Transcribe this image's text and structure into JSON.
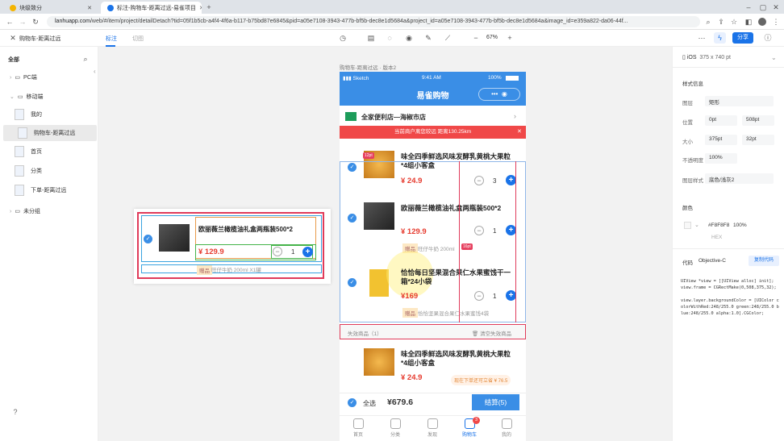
{
  "browser": {
    "tabs": [
      {
        "title": "块级致分",
        "favicon_color": "#f4b400"
      },
      {
        "title": "标注-购物车-距离过远-易雀项目",
        "favicon_color": "#1a73e8"
      }
    ],
    "url_host": "lanhuapp.com",
    "url_rest": "/web/#/item/project/detailDetach?tid=05f1b5cb-a4f4-4f6a-b117-b75bd87e6845&pid=a05e7108-3943-477b-bf5b-dec8e1d5684a&project_id=a05e7108-3943-477b-bf5b-dec8e1d5684a&image_id=e359a822-da06-44f..."
  },
  "app": {
    "breadcrumb": "购物车-距离过远",
    "tabs": [
      "标注",
      "切图"
    ],
    "zoom": "67%",
    "share_label": "分享"
  },
  "sidebar": {
    "header": "全部",
    "groups": [
      {
        "label": "PC端"
      },
      {
        "label": "移动端"
      }
    ],
    "pages": [
      {
        "label": "我的"
      },
      {
        "label": "购物车-距离过远"
      },
      {
        "label": "首页"
      },
      {
        "label": "分类"
      },
      {
        "label": "下单-距离过远"
      }
    ],
    "ungrouped": "未分组",
    "help": "?"
  },
  "artboard": {
    "title": "购物车-距离过远 · 版本2"
  },
  "phone": {
    "status": {
      "carrier": "Sketch",
      "time": "9:41 AM",
      "battery": "100%"
    },
    "nav_title": "易雀购物",
    "store": "全家便利店—海椒市店",
    "warning": "当前商户离您较远 距离130.25km",
    "items": [
      {
        "title": "味全四季鲜选风味发酵乳黄桃大果粒*4组小客盒",
        "price": "¥ 24.9",
        "qty": "3",
        "badge": "12pt"
      },
      {
        "title": "欧丽薇兰橄榄油礼盒两瓶装500*2",
        "price": "¥ 129.9",
        "qty": "1",
        "gift_tag": "赠品",
        "gift": "旺仔牛奶 200ml",
        "badge": "16pt"
      },
      {
        "title": "恰恰每日坚果混合果仁水果蜜饯干一箱*24小袋",
        "price": "¥169",
        "qty": "1",
        "gift_tag": "赠品",
        "gift": "恰恰坚果混合果仁水果蜜饯4袋"
      }
    ],
    "invalid_label": "失效商品（1）",
    "clear_label": "清空失效商品",
    "invalid_item": {
      "title": "味全四季鲜选风味发酵乳黄桃大果粒*4组小客盒",
      "price": "¥ 24.9",
      "note": "现在下单还可立省 ¥ 76.5"
    },
    "footer": {
      "select_all": "全选",
      "total": "¥679.6",
      "checkout": "结算(5)"
    },
    "tabbar": [
      "首页",
      "分类",
      "发现",
      "购物车",
      "我的"
    ],
    "cart_count": "3"
  },
  "zoom_card": {
    "title": "欧丽薇兰橄榄油礼盒两瓶装500*2",
    "price": "¥ 129.9",
    "qty": "1",
    "gift_tag": "赠品",
    "gift": "旺仔牛奶 200ml X1罐"
  },
  "inspector": {
    "device": "iOS",
    "device_size": "375 x 740 pt",
    "section_style": "样式信息",
    "layer_label": "图层",
    "layer_value": "矩形",
    "pos_label": "位置",
    "pos_x": "0pt",
    "pos_y": "508pt",
    "size_label": "大小",
    "size_w": "375pt",
    "size_h": "32pt",
    "opacity_label": "不透明度",
    "opacity": "100%",
    "style_label": "图层样式",
    "style_value": "底色/浅灰2",
    "color_label": "颜色",
    "color_hex": "#F8F8F8",
    "color_pct": "100%",
    "color_mode": "HEX",
    "code_label": "代码",
    "code_lang": "Objective-C",
    "copy_label": "复制代码",
    "code": "UIView *view = [[UIView alloc] init];\nview.frame = CGRectMake(0,508,375,32);\n\nview.layer.backgroundColor = [UIColor colorWithRed:248/255.0 green:248/255.0 blue:248/255.0 alpha:1.0].CGColor;"
  }
}
